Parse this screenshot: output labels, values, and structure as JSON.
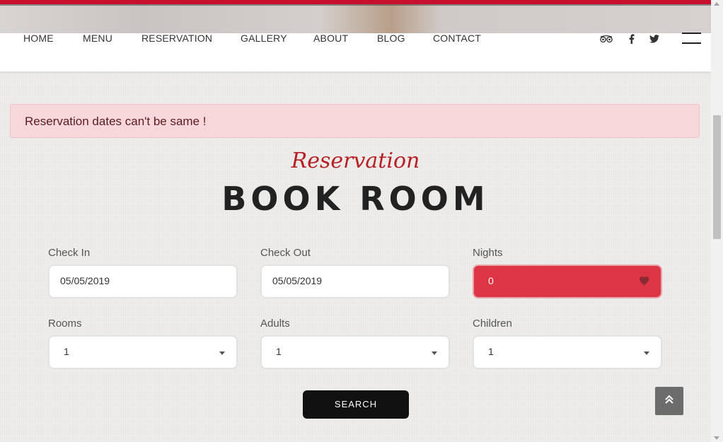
{
  "nav": {
    "items": [
      "HOME",
      "MENU",
      "RESERVATION",
      "GALLERY",
      "ABOUT",
      "BLOG",
      "CONTACT"
    ],
    "social_icons": [
      "tripadvisor-icon",
      "facebook-icon",
      "twitter-icon"
    ]
  },
  "alert": {
    "message": "Reservation dates can't be same !"
  },
  "heading": {
    "script": "Reservation",
    "title": "BOOK ROOM"
  },
  "form": {
    "check_in": {
      "label": "Check In",
      "value": "05/05/2019"
    },
    "check_out": {
      "label": "Check Out",
      "value": "05/05/2019"
    },
    "nights": {
      "label": "Nights",
      "value": "0"
    },
    "rooms": {
      "label": "Rooms",
      "value": "1"
    },
    "adults": {
      "label": "Adults",
      "value": "1"
    },
    "children": {
      "label": "Children",
      "value": "1"
    },
    "search_label": "SEARCH"
  },
  "colors": {
    "accent_red": "#dc3545",
    "brand_red": "#b81f24",
    "alert_bg": "#f8d7da",
    "button_dark": "#111111"
  }
}
